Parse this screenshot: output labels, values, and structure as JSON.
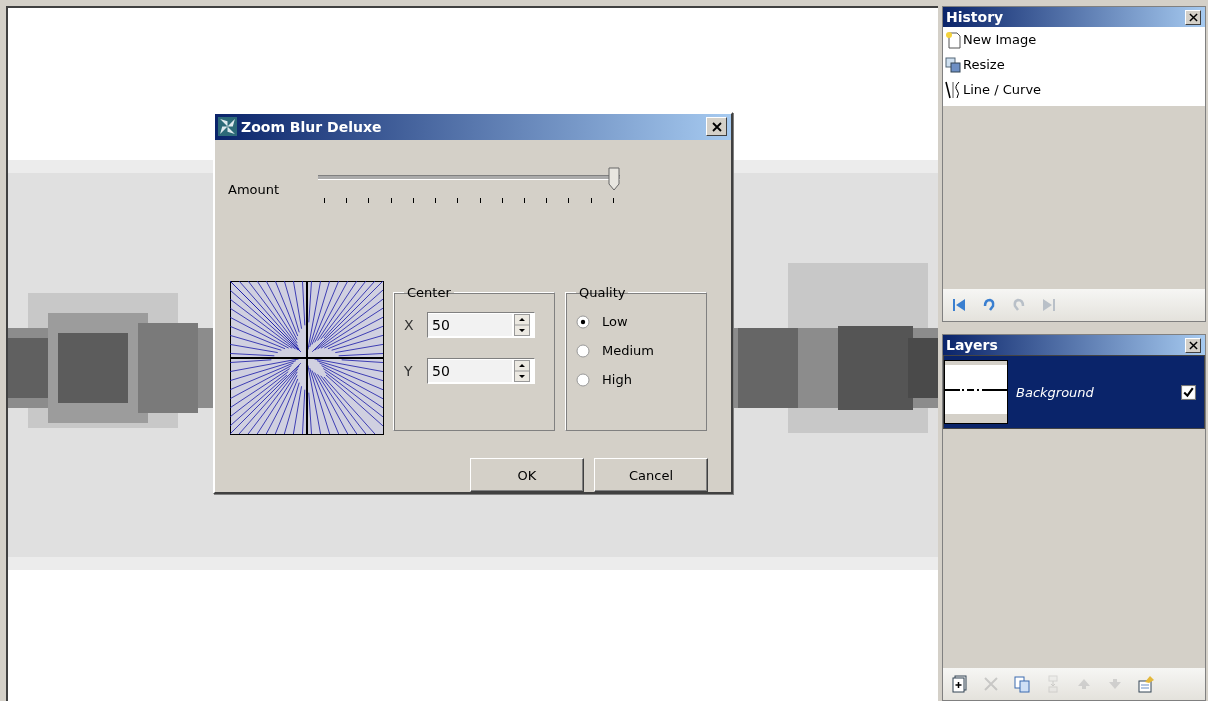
{
  "dialog": {
    "title": "Zoom Blur Deluxe",
    "amount": {
      "label": "Amount",
      "level": 1
    },
    "center": {
      "label": "Center",
      "fields": [
        {
          "label": "X",
          "value": "50"
        },
        {
          "label": "Y",
          "value": "50"
        }
      ]
    },
    "quality": {
      "label": "Quality",
      "options": [
        {
          "label": "Low",
          "selected": true
        },
        {
          "label": "Medium",
          "selected": false
        },
        {
          "label": "High",
          "selected": false
        }
      ]
    },
    "buttons": [
      {
        "label": "OK"
      },
      {
        "label": "Cancel"
      }
    ]
  },
  "history": {
    "title": "History",
    "items": [
      {
        "label": "New Image",
        "kind": "new"
      },
      {
        "label": "Resize",
        "kind": "resize"
      },
      {
        "label": "Line / Curve",
        "kind": "line"
      }
    ],
    "controls": [
      {
        "kind": "first",
        "disabled": false
      },
      {
        "kind": "undo",
        "disabled": false
      },
      {
        "kind": "redo",
        "disabled": true
      },
      {
        "kind": "last",
        "disabled": true
      }
    ]
  },
  "layers": {
    "title": "Layers",
    "items": [
      {
        "name": "Background",
        "visible": true,
        "selected": true
      }
    ],
    "controls": [
      {
        "kind": "add",
        "disabled": false
      },
      {
        "kind": "delete",
        "disabled": true
      },
      {
        "kind": "duplicate",
        "disabled": false
      },
      {
        "kind": "merge",
        "disabled": true
      },
      {
        "kind": "up",
        "disabled": true
      },
      {
        "kind": "down",
        "disabled": true
      },
      {
        "kind": "properties",
        "disabled": false
      }
    ]
  }
}
